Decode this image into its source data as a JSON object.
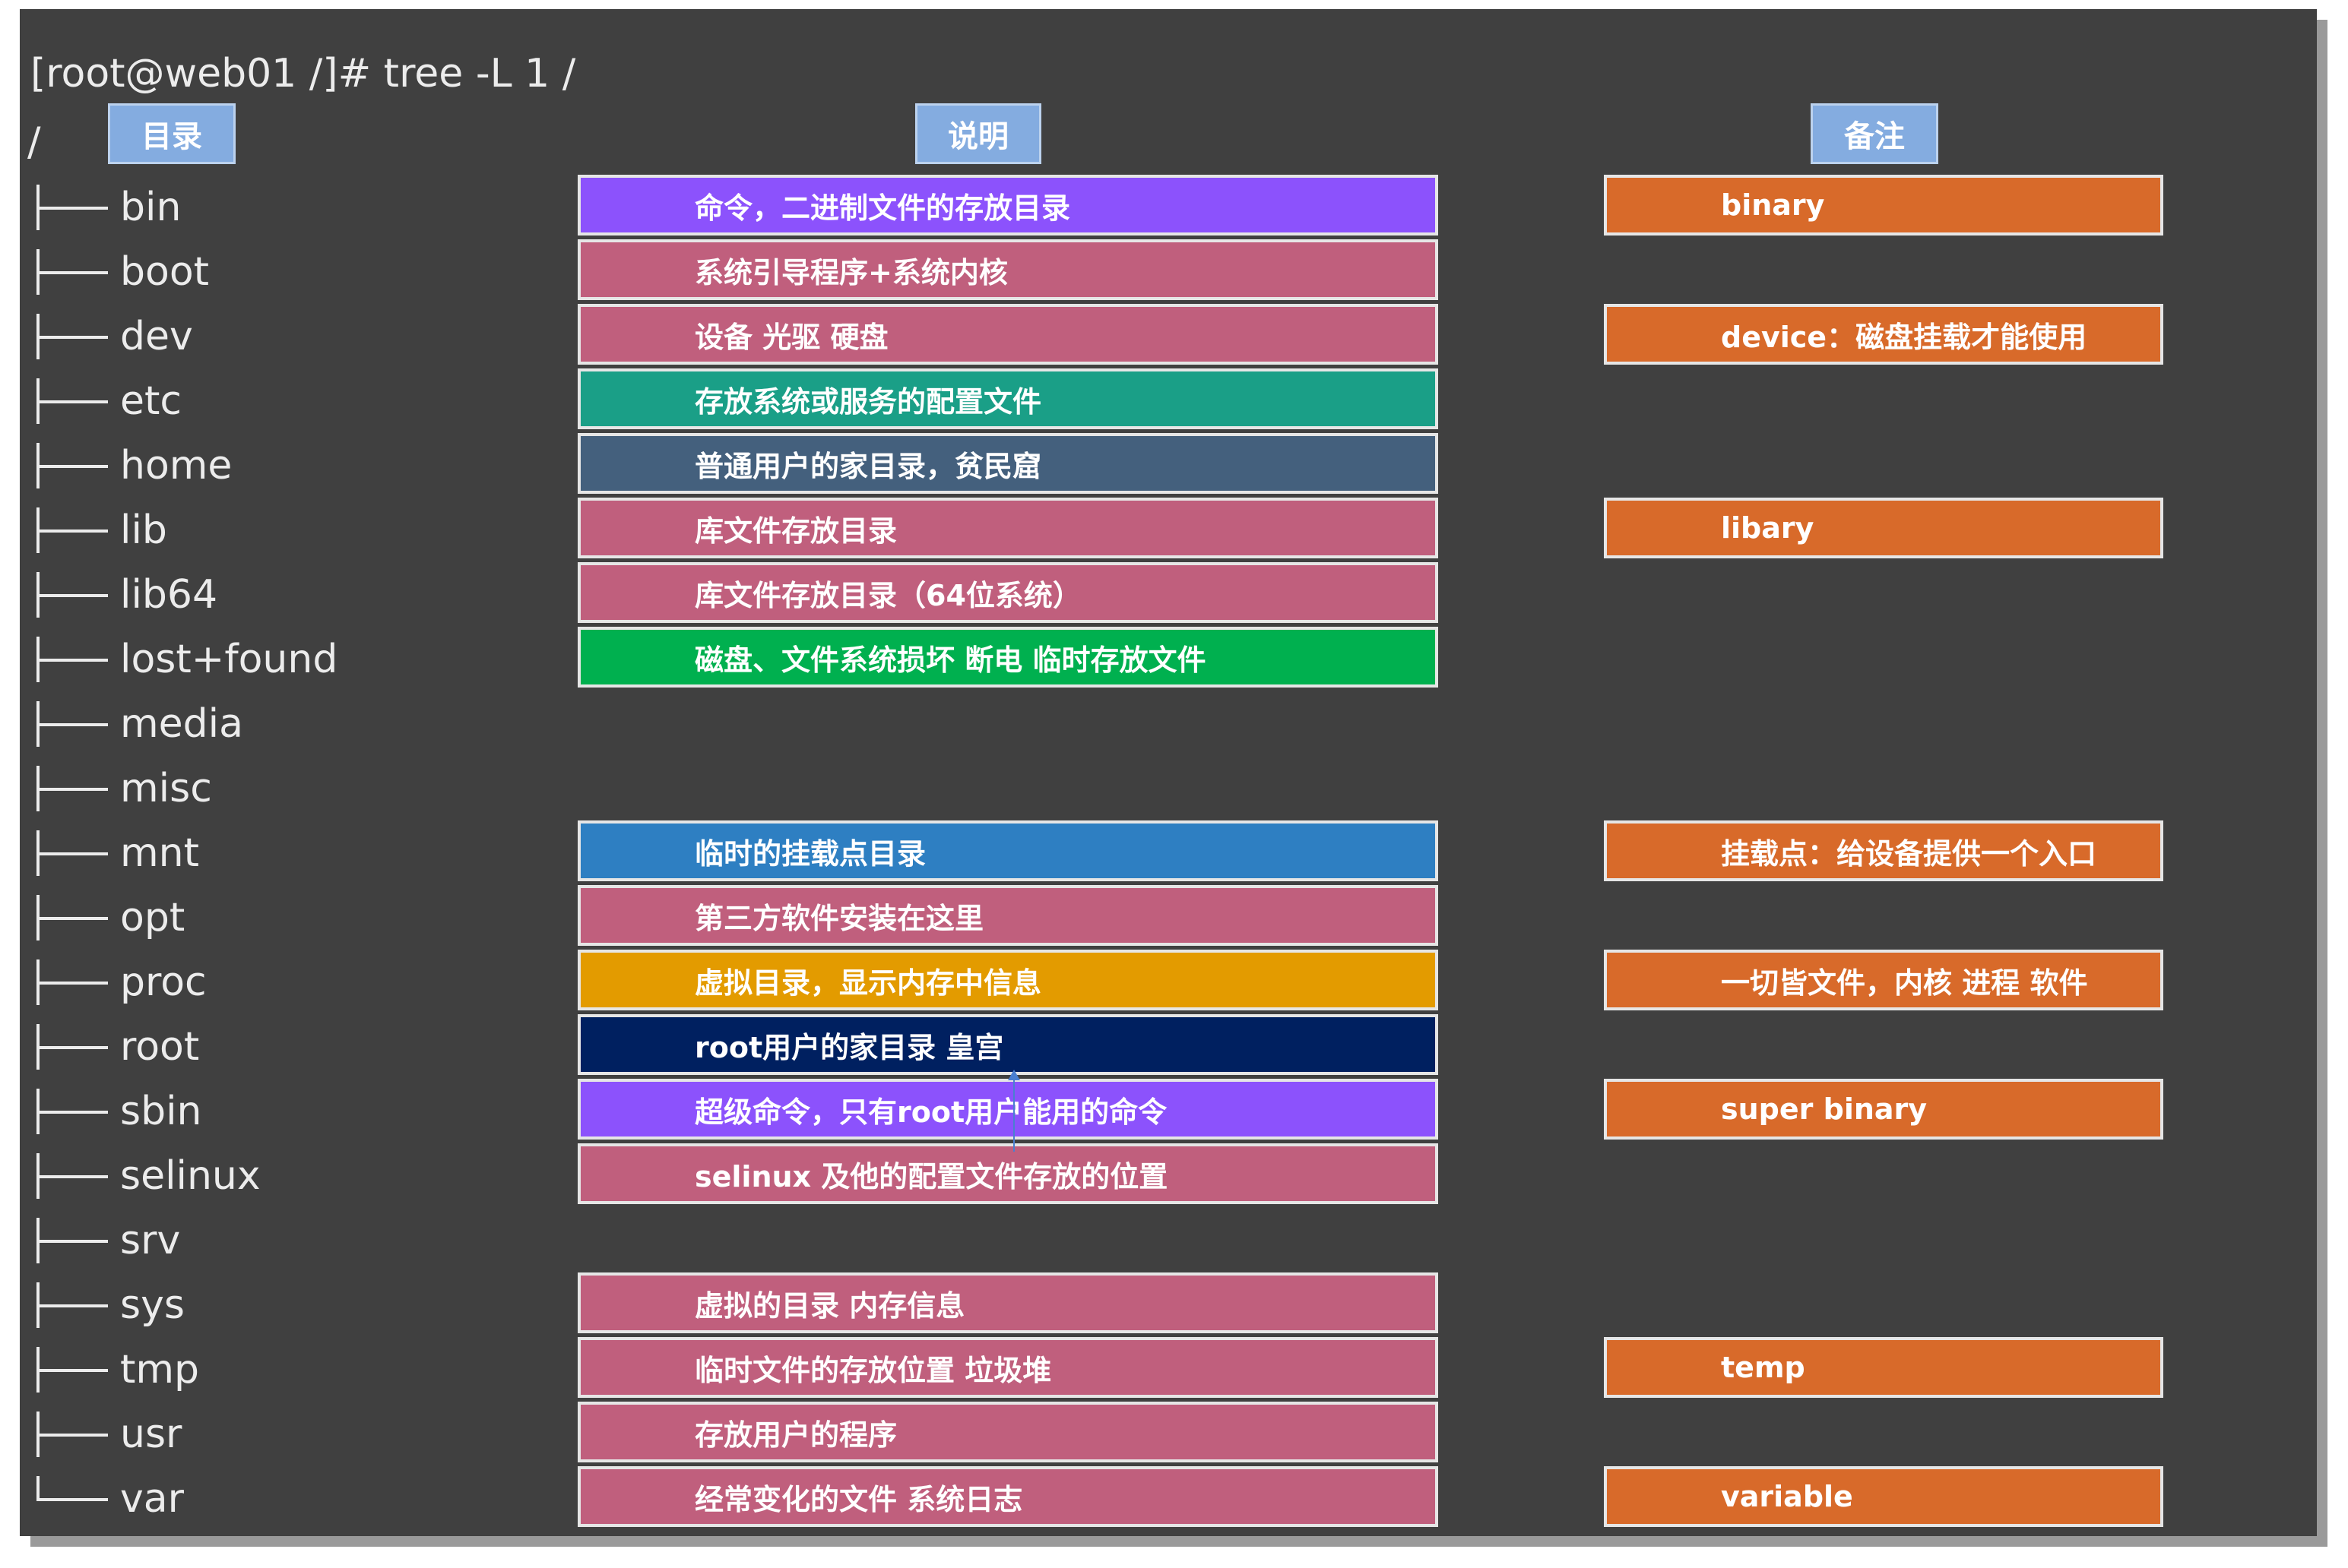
{
  "command": "[root@web01 /]# tree -L 1 /",
  "root": "/",
  "headers": {
    "directory": "目录",
    "description": "说明",
    "notes": "备注"
  },
  "entries": [
    {
      "name": "bin",
      "branch": "├──",
      "desc": "命令，二进制文件的存放目录",
      "desc_color": "#8c52fc",
      "note": "binary"
    },
    {
      "name": "boot",
      "branch": "├──",
      "desc": "系统引导程序+系统内核",
      "desc_color": "#c05f7d",
      "note": null
    },
    {
      "name": "dev",
      "branch": "├──",
      "desc": "设备 光驱 硬盘",
      "desc_color": "#c05f7d",
      "note": "device：磁盘挂载才能使用"
    },
    {
      "name": "etc",
      "branch": "├──",
      "desc": "存放系统或服务的配置文件",
      "desc_color": "#1a9f87",
      "note": null
    },
    {
      "name": "home",
      "branch": "├──",
      "desc": "普通用户的家目录，贫民窟",
      "desc_color": "#44607d",
      "note": null
    },
    {
      "name": "lib",
      "branch": "├──",
      "desc": "库文件存放目录",
      "desc_color": "#c05f7d",
      "note": "libary"
    },
    {
      "name": "lib64",
      "branch": "├──",
      "desc": "库文件存放目录（64位系统）",
      "desc_color": "#c05f7d",
      "note": null
    },
    {
      "name": "lost+found",
      "branch": "├──",
      "desc": "磁盘、文件系统损坏 断电 临时存放文件",
      "desc_color": "#00b04f",
      "note": null
    },
    {
      "name": "media",
      "branch": "├──",
      "desc": null,
      "desc_color": null,
      "note": null
    },
    {
      "name": "misc",
      "branch": "├──",
      "desc": null,
      "desc_color": null,
      "note": null
    },
    {
      "name": "mnt",
      "branch": "├──",
      "desc": "临时的挂载点目录",
      "desc_color": "#2e7fc2",
      "note": "挂载点：给设备提供一个入口"
    },
    {
      "name": "opt",
      "branch": "├──",
      "desc": "第三方软件安装在这里",
      "desc_color": "#c05f7d",
      "note": null
    },
    {
      "name": "proc",
      "branch": "├──",
      "desc": "虚拟目录，显示内存中信息",
      "desc_color": "#e39b00",
      "note": "一切皆文件，内核 进程 软件"
    },
    {
      "name": "root",
      "branch": "├──",
      "desc": "root用户的家目录 皇宫",
      "desc_color": "#002060",
      "note": null
    },
    {
      "name": "sbin",
      "branch": "├──",
      "desc": "超级命令，只有root用户能用的命令",
      "desc_color": "#8c52fc",
      "note": "super  binary"
    },
    {
      "name": "selinux",
      "branch": "├──",
      "desc": "selinux 及他的配置文件存放的位置",
      "desc_color": "#c05f7d",
      "note": null
    },
    {
      "name": "srv",
      "branch": "├──",
      "desc": null,
      "desc_color": null,
      "note": null
    },
    {
      "name": "sys",
      "branch": "├──",
      "desc": "虚拟的目录 内存信息",
      "desc_color": "#c05f7d",
      "note": null
    },
    {
      "name": "tmp",
      "branch": "├──",
      "desc": "临时文件的存放位置 垃圾堆",
      "desc_color": "#c05f7d",
      "note": "temp"
    },
    {
      "name": "usr",
      "branch": "├──",
      "desc": "存放用户的程序",
      "desc_color": "#c05f7d",
      "note": null
    },
    {
      "name": "var",
      "branch": "└──",
      "desc": "经常变化的文件 系统日志",
      "desc_color": "#c05f7d",
      "note": "variable"
    }
  ]
}
